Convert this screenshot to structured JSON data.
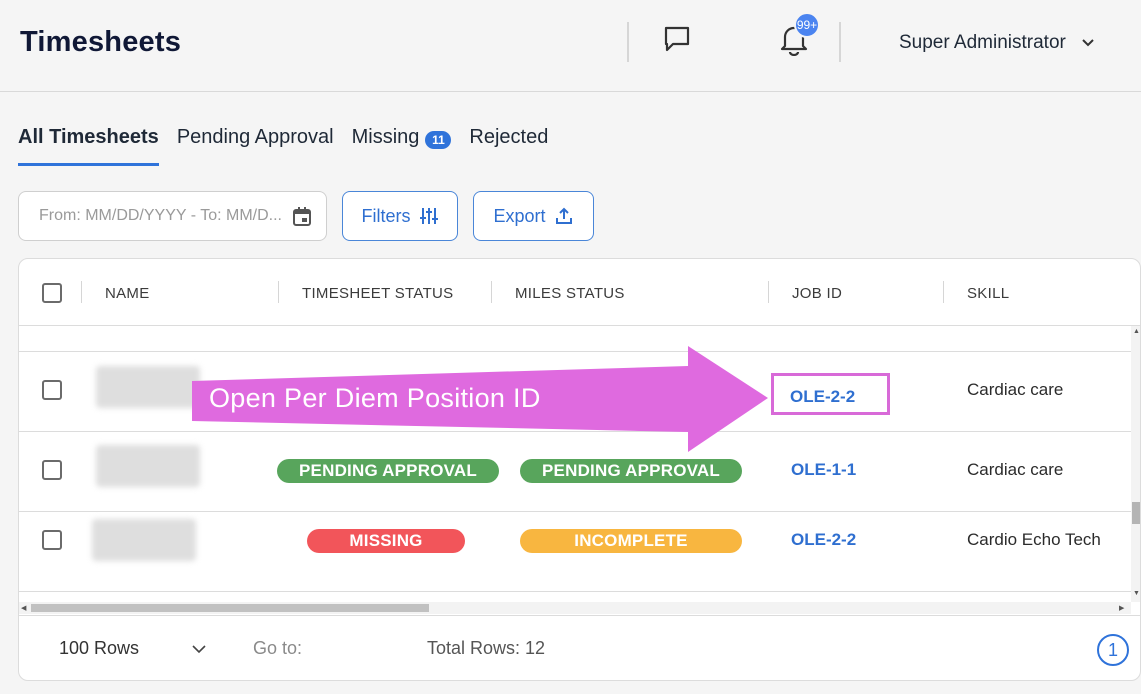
{
  "header": {
    "title": "Timesheets",
    "notification_count": "99+",
    "user_name": "Super Administrator"
  },
  "tabs": [
    {
      "label": "All Timesheets",
      "active": true
    },
    {
      "label": "Pending Approval"
    },
    {
      "label": "Missing",
      "badge": "11"
    },
    {
      "label": "Rejected"
    }
  ],
  "toolbar": {
    "date_placeholder": "From: MM/DD/YYYY - To: MM/D...",
    "filters_label": "Filters",
    "export_label": "Export"
  },
  "table": {
    "columns": [
      "NAME",
      "TIMESHEET STATUS",
      "MILES STATUS",
      "JOB ID",
      "SKILL"
    ],
    "rows": [
      {
        "timesheet_status": "",
        "miles_status": "",
        "job_id": "OLE-2-2",
        "skill": "Cardiac care"
      },
      {
        "timesheet_status": "PENDING APPROVAL",
        "miles_status": "PENDING APPROVAL",
        "job_id": "OLE-1-1",
        "skill": "Cardiac care"
      },
      {
        "timesheet_status": "MISSING",
        "miles_status": "INCOMPLETE",
        "job_id": "OLE-2-2",
        "skill": "Cardio Echo Tech"
      }
    ]
  },
  "footer": {
    "rows_per_page": "100 Rows",
    "goto_label": "Go to:",
    "total_rows": "Total Rows: 12",
    "current_page": "1"
  },
  "annotation": {
    "text": "Open Per Diem Position ID",
    "color": "#df6adf"
  },
  "colors": {
    "accent": "#2f73da",
    "status_green": "#58a55c",
    "status_red": "#f2555a",
    "status_orange": "#f8b640"
  }
}
